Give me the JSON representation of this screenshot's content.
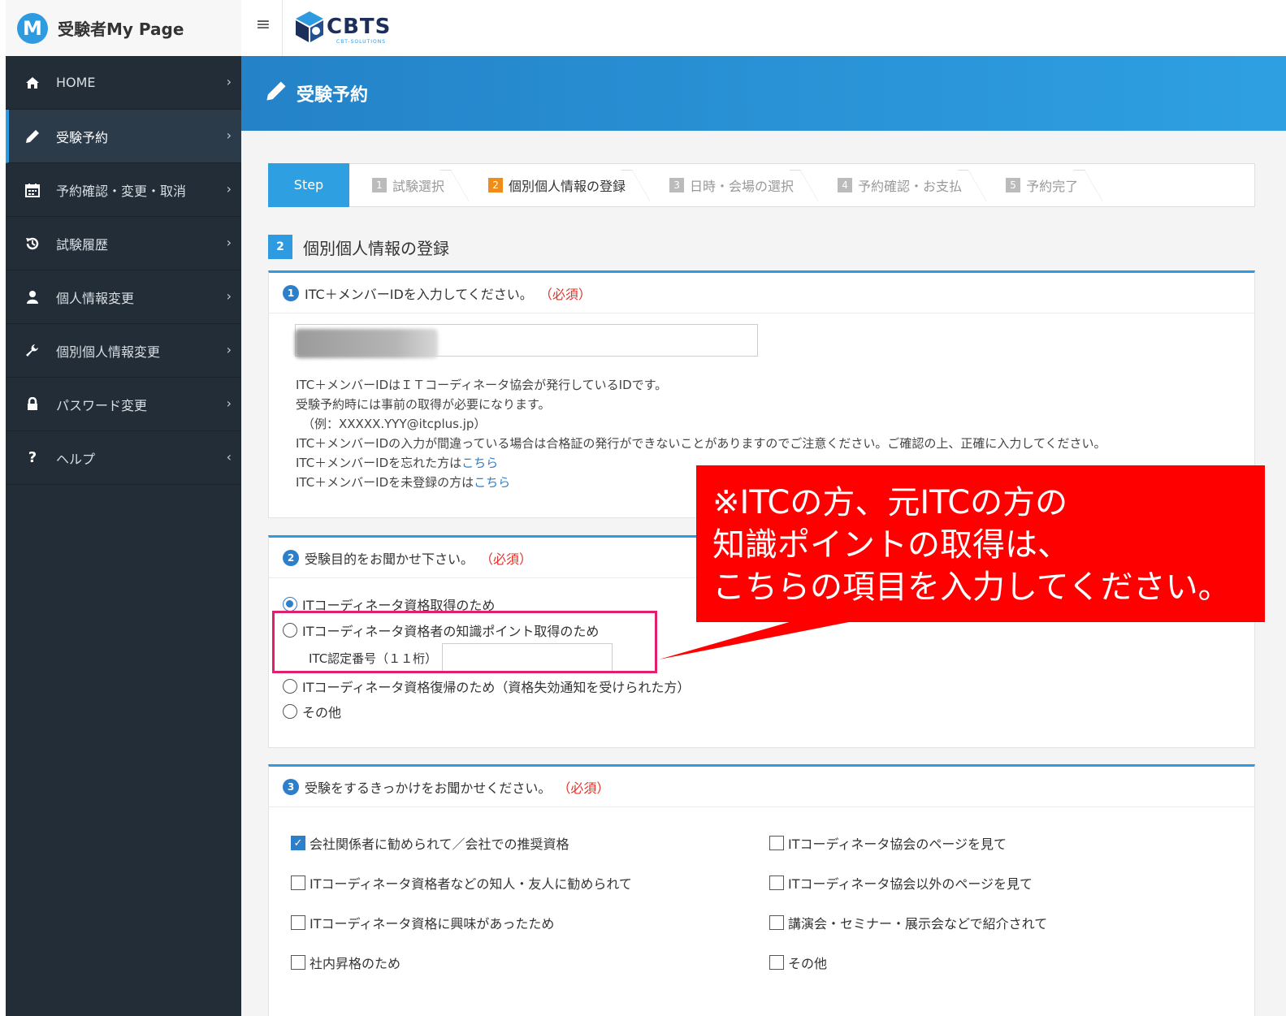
{
  "brand": {
    "logo_letter": "M",
    "title": "受験者My Page"
  },
  "topbar": {
    "menu_icon": "≡",
    "company_logo_text": "CBTS",
    "company_logo_sub": "CBT-SOLUTIONS"
  },
  "sidebar": {
    "items": [
      {
        "label": "HOME",
        "icon": "home-icon",
        "chevron": "›",
        "active": false
      },
      {
        "label": "受験予約",
        "icon": "pencil-icon",
        "chevron": "›",
        "active": true
      },
      {
        "label": "予約確認・変更・取消",
        "icon": "calendar-icon",
        "chevron": "›",
        "active": false
      },
      {
        "label": "試験履歴",
        "icon": "history-icon",
        "chevron": "›",
        "active": false
      },
      {
        "label": "個人情報変更",
        "icon": "user-icon",
        "chevron": "›",
        "active": false
      },
      {
        "label": "個別個人情報変更",
        "icon": "wrench-icon",
        "chevron": "›",
        "active": false
      },
      {
        "label": "パスワード変更",
        "icon": "lock-icon",
        "chevron": "›",
        "active": false
      },
      {
        "label": "ヘルプ",
        "icon": "question-icon",
        "chevron": "‹",
        "active": false
      }
    ]
  },
  "header": {
    "title": "受験予約"
  },
  "steps": {
    "first": "Step",
    "items": [
      {
        "num": "1",
        "label": "試験選択"
      },
      {
        "num": "2",
        "label": "個別個人情報の登録",
        "current": true
      },
      {
        "num": "3",
        "label": "日時・会場の選択"
      },
      {
        "num": "4",
        "label": "予約確認・お支払"
      },
      {
        "num": "5",
        "label": "予約完了"
      }
    ]
  },
  "section": {
    "badge": "2",
    "title": "個別個人情報の登録"
  },
  "q1": {
    "num": "1",
    "label": "ITC＋メンバーIDを入力してください。",
    "required": "（必須）",
    "desc": [
      "ITC＋メンバーIDはＩＴコーディネータ協会が発行しているIDです。",
      "受験予約時には事前の取得が必要になります。",
      "（例：XXXXX.YYY@itcplus.jp）",
      "ITC＋メンバーIDの入力が間違っている場合は合格証の発行ができないことがありますのでご注意ください。ご確認の上、正確に入力してください。"
    ],
    "forgot_prefix": "ITC＋メンバーIDを忘れた方は",
    "forgot_link": "こちら",
    "unreg_prefix": "ITC＋メンバーIDを未登録の方は",
    "unreg_link": "こちら"
  },
  "q2": {
    "num": "2",
    "label": "受験目的をお聞かせ下さい。",
    "required": "（必須）",
    "options": [
      {
        "label": "ITコーディネータ資格取得のため",
        "selected": true
      },
      {
        "label": "ITコーディネータ資格者の知識ポイント取得のため",
        "selected": false
      },
      {
        "label": "ITコーディネータ資格復帰のため（資格失効通知を受けられた方）",
        "selected": false
      },
      {
        "label": "その他",
        "selected": false
      }
    ],
    "itc_number_label": "ITC認定番号（１１桁）",
    "itc_number_value": ""
  },
  "q3": {
    "num": "3",
    "label": "受験をするきっかけをお聞かせください。",
    "required": "（必須）",
    "options_left": [
      {
        "label": "会社関係者に勧められて／会社での推奨資格",
        "checked": true
      },
      {
        "label": "ITコーディネータ資格者などの知人・友人に勧められて",
        "checked": false
      },
      {
        "label": "ITコーディネータ資格に興味があったため",
        "checked": false
      },
      {
        "label": "社内昇格のため",
        "checked": false
      }
    ],
    "options_right": [
      {
        "label": "ITコーディネータ協会のページを見て",
        "checked": false
      },
      {
        "label": "ITコーディネータ協会以外のページを見て",
        "checked": false
      },
      {
        "label": "講演会・セミナー・展示会などで紹介されて",
        "checked": false
      },
      {
        "label": "その他",
        "checked": false
      }
    ]
  },
  "annotation": {
    "lines": [
      "※ITCの方、元ITCの方の",
      "知識ポイントの取得は、",
      "こちらの項目を入力してください。"
    ]
  },
  "colors": {
    "accent": "#2e9ae0",
    "sidebar": "#222d38",
    "required": "#e0332a",
    "callout": "#ff0000",
    "highlight": "#e0206e"
  }
}
